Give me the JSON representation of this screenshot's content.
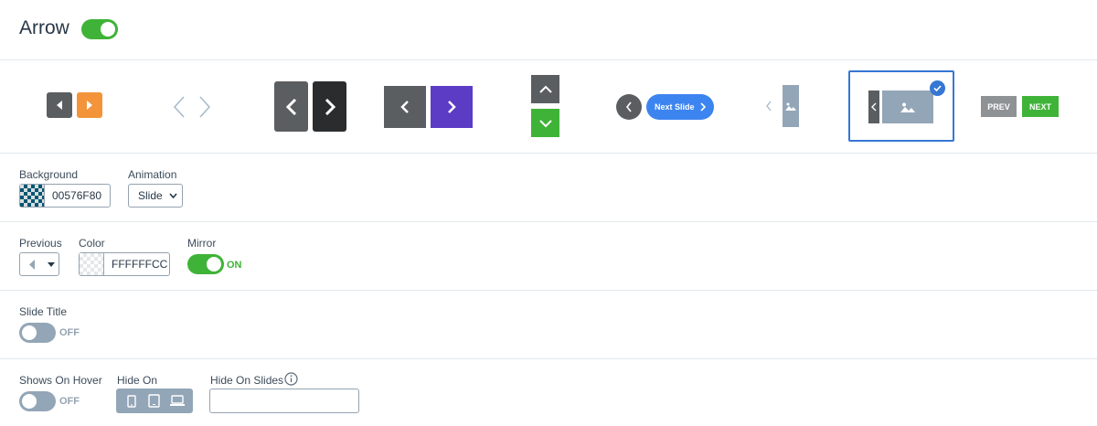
{
  "header": {
    "title": "Arrow",
    "enabled": true
  },
  "gallery": {
    "styles": [
      {
        "name": "small-square-dark-orange"
      },
      {
        "name": "outline-chevrons"
      },
      {
        "name": "large-dark-grey-black"
      },
      {
        "name": "grey-purple"
      },
      {
        "name": "vertical-grey-green"
      },
      {
        "name": "circle-pill",
        "pill_label": "Next Slide"
      },
      {
        "name": "image-thumbnail-small"
      },
      {
        "name": "image-thumbnail-large",
        "selected": true
      },
      {
        "name": "text-buttons",
        "prev_label": "PREV",
        "next_label": "NEXT"
      }
    ]
  },
  "background": {
    "label": "Background",
    "color_value": "00576F80"
  },
  "animation": {
    "label": "Animation",
    "value": "Slide"
  },
  "previous": {
    "label": "Previous",
    "icon": "caret-left-icon"
  },
  "color": {
    "label": "Color",
    "color_value": "FFFFFFCC"
  },
  "mirror": {
    "label": "Mirror",
    "state": "ON"
  },
  "slide_title": {
    "label": "Slide Title",
    "state": "OFF"
  },
  "shows_on_hover": {
    "label": "Shows On Hover",
    "state": "OFF"
  },
  "hide_on": {
    "label": "Hide On",
    "devices": [
      "mobile-icon",
      "tablet-icon",
      "laptop-icon"
    ]
  },
  "hide_on_slides": {
    "label": "Hide On Slides",
    "value": ""
  },
  "colors": {
    "accent_green": "#3fb337",
    "toggle_off": "#93a6b7",
    "selected_blue": "#3677d4",
    "purple": "#5c3cc4",
    "orange": "#f3943a",
    "pill_blue": "#3c84f0"
  }
}
